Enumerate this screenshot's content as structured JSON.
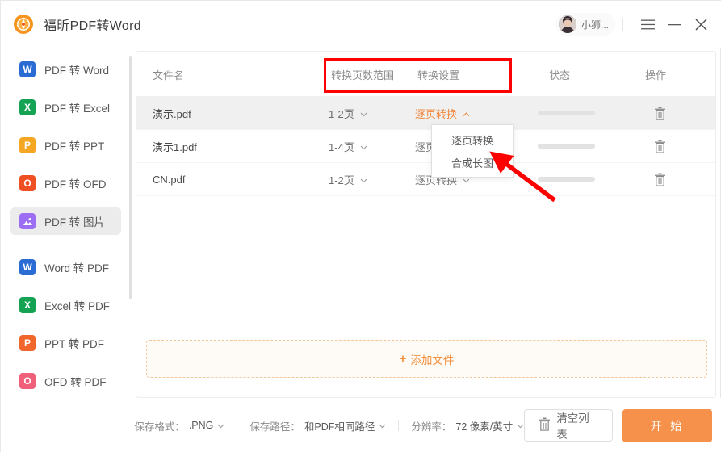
{
  "window": {
    "app_title": "福昕PDF转Word",
    "logo_icon": "foxit-logo-icon",
    "user_name": "小狮...",
    "menu_icon": "hamburger-menu-icon",
    "minimize_icon": "minimize-icon",
    "close_icon": "close-icon",
    "colors": {
      "accent": "#f5914b",
      "annotation": "#ff0000",
      "selected_row": "#f0f0f0"
    }
  },
  "sidebar": {
    "items": [
      {
        "label": "PDF 转 Word",
        "icon": "word-icon",
        "badge": "W",
        "color": "#2b6cd4",
        "active": false
      },
      {
        "label": "PDF 转 Excel",
        "icon": "excel-icon",
        "badge": "X",
        "color": "#13a352",
        "active": false
      },
      {
        "label": "PDF 转 PPT",
        "icon": "ppt-icon",
        "badge": "P",
        "color": "#f5a623",
        "active": false
      },
      {
        "label": "PDF 转 OFD",
        "icon": "ofd-icon",
        "badge": "O",
        "color": "#f04e23",
        "active": false
      },
      {
        "label": "PDF 转 图片",
        "icon": "image-icon",
        "badge": "▨",
        "color": "#9b6ef3",
        "active": true
      }
    ],
    "items2": [
      {
        "label": "Word 转 PDF",
        "icon": "word-icon",
        "badge": "W",
        "color": "#2b6cd4"
      },
      {
        "label": "Excel 转 PDF",
        "icon": "excel-icon",
        "badge": "X",
        "color": "#13a352"
      },
      {
        "label": "PPT 转 PDF",
        "icon": "ppt-icon",
        "badge": "P",
        "color": "#f0662b"
      },
      {
        "label": "OFD 转 PDF",
        "icon": "ofd-icon",
        "badge": "O",
        "color": "#f0607a"
      }
    ]
  },
  "table": {
    "headers": {
      "name": "文件名",
      "range": "转换页数范围",
      "setting": "转换设置",
      "state": "状态",
      "action": "操作"
    },
    "rows": [
      {
        "name": "演示.pdf",
        "range": "1-2页",
        "setting": "逐页转换",
        "chevron": "▲",
        "selected": true,
        "delete_icon": "trash-icon"
      },
      {
        "name": "演示1.pdf",
        "range": "1-4页",
        "setting": "逐页转换",
        "chevron": "▼",
        "selected": false,
        "delete_icon": "trash-icon"
      },
      {
        "name": "CN.pdf",
        "range": "1-2页",
        "setting": "逐页转换",
        "chevron": "▼",
        "selected": false,
        "delete_icon": "trash-icon"
      }
    ],
    "add_file": "添加文件",
    "add_file_plus": "+"
  },
  "dropdown": {
    "options": [
      {
        "label": "逐页转换"
      },
      {
        "label": "合成长图"
      }
    ]
  },
  "bottom": {
    "format_label": "保存格式：",
    "format_value": ".PNG",
    "path_label": "保存路径：",
    "path_value": "和PDF相同路径",
    "dpi_label": "分辨率：",
    "dpi_value": "72 像素/英寸",
    "clear_label": "清空列表",
    "clear_icon": "trash-icon",
    "start_label": "开 始"
  },
  "annotations": {
    "rect_name": "red-highlight-rectangle",
    "arrow_name": "red-pointer-arrow"
  }
}
